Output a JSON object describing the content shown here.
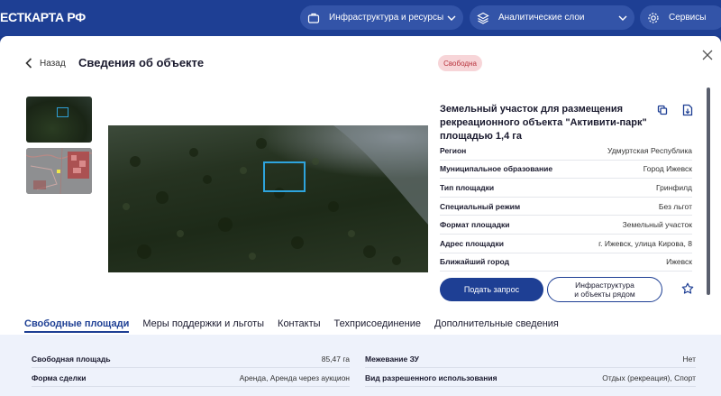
{
  "header": {
    "brand": "ЕСТКАРТА РФ",
    "nav": [
      {
        "label": "Инфраструктура и ресурсы",
        "icon": "briefcase-icon"
      },
      {
        "label": "Аналитические слои",
        "icon": "layers-icon"
      },
      {
        "label": "Сервисы",
        "icon": "gear-icon"
      }
    ]
  },
  "modal": {
    "back_label": "Назад",
    "title": "Сведения об объекте",
    "status_badge": "Свободна",
    "object_title": "Земельный участок для размещения рекреационного объекта \"Активити-парк\" площадью 1,4 га",
    "properties": [
      {
        "key": "Регион",
        "value": "Удмуртская Республика"
      },
      {
        "key": "Муниципальное образование",
        "value": "Город Ижевск"
      },
      {
        "key": "Тип площадки",
        "value": "Гринфилд"
      },
      {
        "key": "Специальный режим",
        "value": "Без льгот"
      },
      {
        "key": "Формат площадки",
        "value": "Земельный участок"
      },
      {
        "key": "Адрес площадки",
        "value": "г. Ижевск, улица Кирова, 8"
      },
      {
        "key": "Ближайший город",
        "value": "Ижевск"
      }
    ],
    "request_button": "Подать запрос",
    "infra_button_line1": "Инфраструктура",
    "infra_button_line2": "и объекты рядом",
    "tabs": [
      {
        "label": "Свободные площади",
        "active": true
      },
      {
        "label": "Меры поддержки и льготы",
        "active": false
      },
      {
        "label": "Контакты",
        "active": false
      },
      {
        "label": "Техприсоединение",
        "active": false
      },
      {
        "label": "Дополнительные сведения",
        "active": false
      }
    ],
    "details": [
      {
        "key": "Свободная площадь",
        "value": "85,47 га"
      },
      {
        "key": "Межевание ЗУ",
        "value": "Нет"
      },
      {
        "key": "Форма сделки",
        "value": "Аренда, Аренда через аукцион"
      },
      {
        "key": "Вид разрешенного использования",
        "value": "Отдых (рекреация), Спорт"
      }
    ]
  },
  "colors": {
    "brand_blue": "#1e3f94",
    "status_bg": "#f7d5d8",
    "status_text": "#b8333d",
    "selection": "#2ea4dd"
  }
}
